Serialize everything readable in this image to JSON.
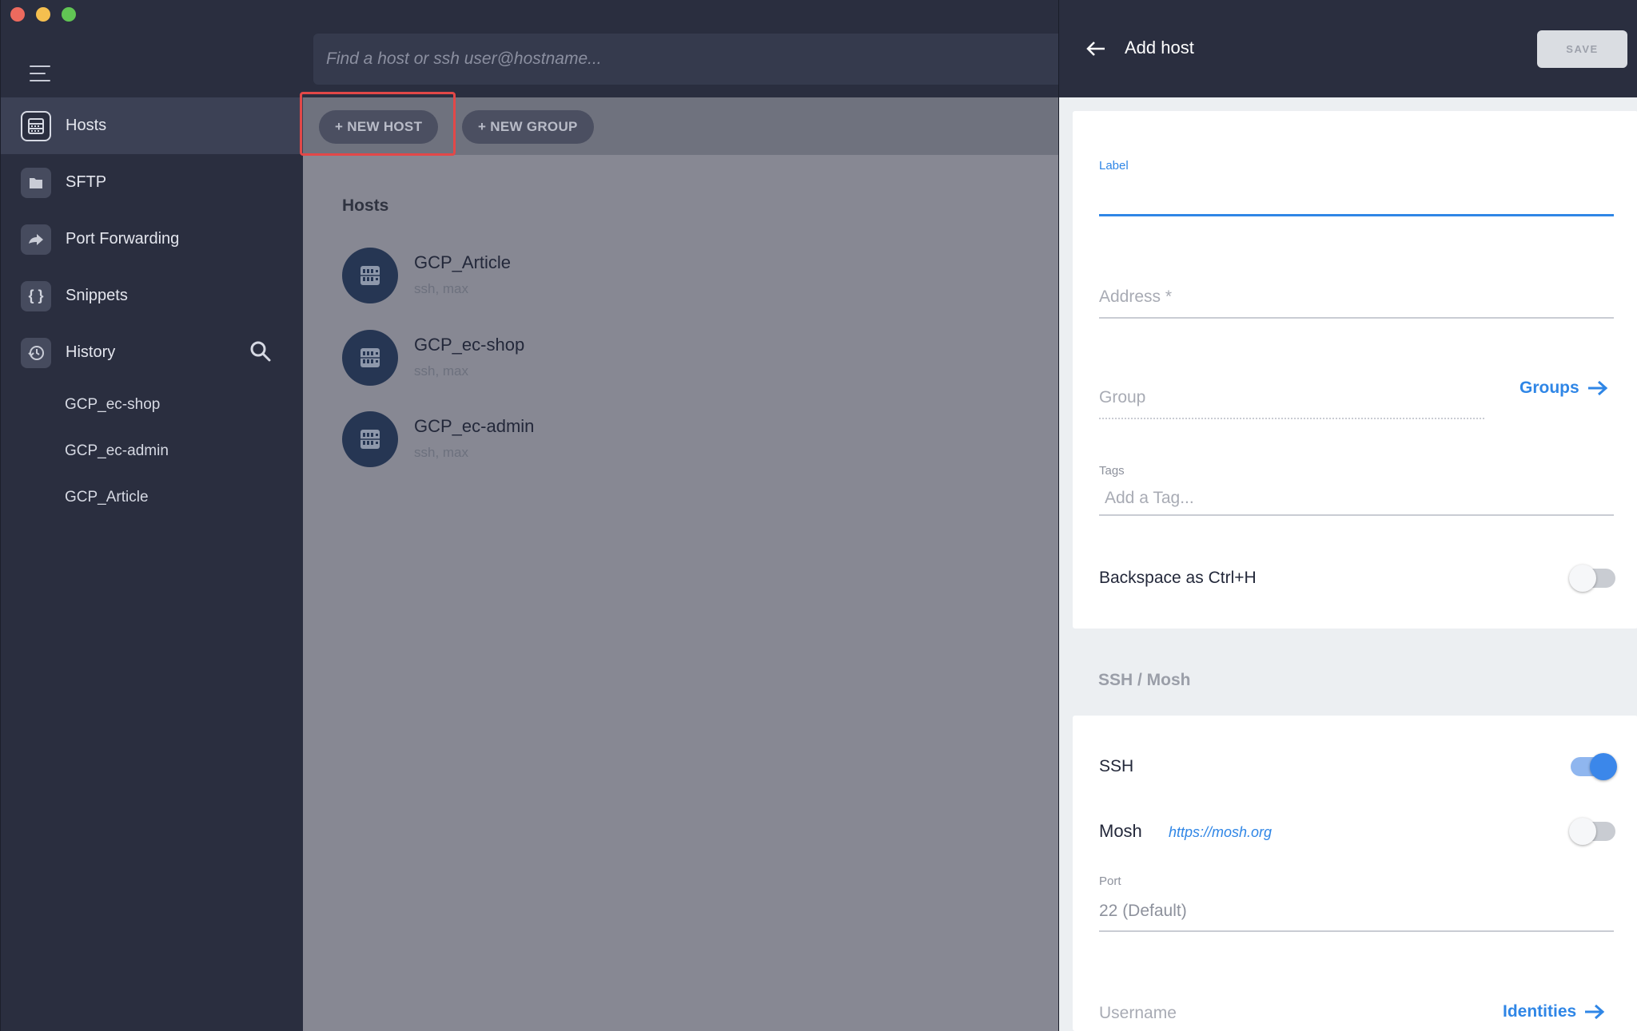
{
  "window": {
    "traffic_lights": [
      "close",
      "minimize",
      "zoom"
    ]
  },
  "search": {
    "placeholder": "Find a host or ssh user@hostname..."
  },
  "sidebar": {
    "items": [
      {
        "label": "Hosts",
        "icon": "server-icon",
        "active": true
      },
      {
        "label": "SFTP",
        "icon": "folder-icon",
        "active": false
      },
      {
        "label": "Port Forwarding",
        "icon": "forward-arrow-icon",
        "active": false
      },
      {
        "label": "Snippets",
        "icon": "braces-icon",
        "active": false
      },
      {
        "label": "History",
        "icon": "history-clock-icon",
        "active": false
      }
    ],
    "history_items": [
      "GCP_ec-shop",
      "GCP_ec-admin",
      "GCP_Article"
    ]
  },
  "toolbar": {
    "new_host_label": "+ NEW HOST",
    "new_group_label": "+ NEW GROUP"
  },
  "hosts_section": {
    "title": "Hosts",
    "hosts": [
      {
        "name": "GCP_Article",
        "sub": "ssh, max"
      },
      {
        "name": "GCP_ec-shop",
        "sub": "ssh, max"
      },
      {
        "name": "GCP_ec-admin",
        "sub": "ssh, max"
      }
    ]
  },
  "panel": {
    "title": "Add host",
    "save_label": "SAVE",
    "label_field": {
      "label": "Label",
      "value": ""
    },
    "address_placeholder": "Address *",
    "group_placeholder": "Group",
    "groups_link": "Groups",
    "tags_label": "Tags",
    "tags_placeholder": "Add a Tag...",
    "backspace_label": "Backspace as Ctrl+H",
    "backspace_on": false,
    "ssh_mosh_header": "SSH / Mosh",
    "ssh_label": "SSH",
    "ssh_on": true,
    "mosh_label": "Mosh",
    "mosh_link": "https://mosh.org",
    "mosh_on": false,
    "port_label": "Port",
    "port_placeholder": "22 (Default)",
    "username_placeholder": "Username",
    "identities_link": "Identities"
  },
  "colors": {
    "accent": "#2f86e6",
    "sidebar_bg": "#2a2e3f",
    "highlight": "#e24848"
  }
}
